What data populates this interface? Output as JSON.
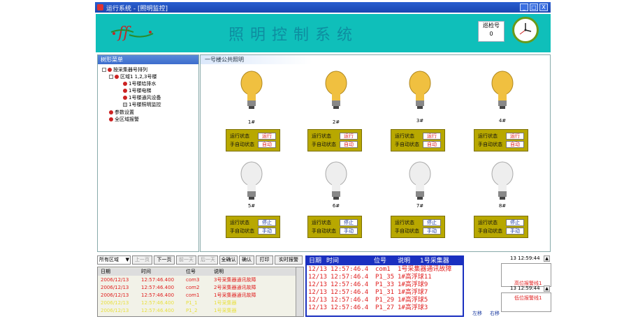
{
  "window": {
    "title": "运行系统 - [照明监控]",
    "min": "_",
    "restore": "□",
    "close": "X"
  },
  "header": {
    "system_title": "照明控制系统",
    "round_label": "巡检号",
    "round_value": "0"
  },
  "sidebar": {
    "title": "树形菜单",
    "tree": [
      {
        "label": "按采集器号排列",
        "level": 0
      },
      {
        "label": "区域1      1,2,3号楼",
        "level": 1
      },
      {
        "label": "1号楼给排水",
        "level": 2
      },
      {
        "label": "1号楼电梯",
        "level": 2
      },
      {
        "label": "1号楼通风设备",
        "level": 2
      },
      {
        "label": "1号楼照明监控",
        "level": 2
      },
      {
        "label": "参数设置",
        "level": 0
      },
      {
        "label": "全区域报警",
        "level": 0
      }
    ]
  },
  "main": {
    "title": "一号楼公共照明",
    "status_label": "运行状态",
    "mode_label": "手自动状态",
    "lamps": [
      {
        "label": "1#",
        "status": "运行",
        "mode": "自动",
        "on": true
      },
      {
        "label": "2#",
        "status": "运行",
        "mode": "自动",
        "on": true
      },
      {
        "label": "3#",
        "status": "运行",
        "mode": "自动",
        "on": true
      },
      {
        "label": "4#",
        "status": "运行",
        "mode": "自动",
        "on": true
      },
      {
        "label": "5#",
        "status": "停止",
        "mode": "手动",
        "on": false
      },
      {
        "label": "6#",
        "status": "停止",
        "mode": "手动",
        "on": false
      },
      {
        "label": "7#",
        "status": "停止",
        "mode": "手动",
        "on": false
      },
      {
        "label": "8#",
        "status": "停止",
        "mode": "手动",
        "on": false
      }
    ]
  },
  "toolbar": {
    "area_select": "所有区域",
    "buttons": [
      "上一页",
      "下一页",
      "前一天",
      "后一天",
      "全确认",
      "确认",
      "打印",
      "实时报警"
    ]
  },
  "history": {
    "columns": [
      "日期",
      "时间",
      "位号",
      "说明"
    ],
    "rows": [
      {
        "date": "2006/12/13",
        "time": "12:57:46.400",
        "tag": "com3",
        "desc": "3号采集器通讯故障"
      },
      {
        "date": "2006/12/13",
        "time": "12:57:46.400",
        "tag": "com2",
        "desc": "2号采集器通讯故障"
      },
      {
        "date": "2006/12/13",
        "time": "12:57:46.400",
        "tag": "com1",
        "desc": "1号采集器通讯故障"
      },
      {
        "date": "2006/12/13",
        "time": "12:57:46.400",
        "tag": "P1_1",
        "desc": "1号采集器"
      },
      {
        "date": "2006/12/13",
        "time": "12:57:46.400",
        "tag": "P1_2",
        "desc": "1号采集器"
      }
    ]
  },
  "realtime": {
    "header": {
      "date": "日期",
      "time": "时间",
      "tag": "位号",
      "desc": "说明",
      "source": "1号采集器"
    },
    "rows": [
      {
        "date": "12/13",
        "time": "12:57:46.4",
        "tag": "com1",
        "desc": "1号采集器通讯故障"
      },
      {
        "date": "12/13",
        "time": "12:57:46.4",
        "tag": "P1_35",
        "desc": "1#高浮球11"
      },
      {
        "date": "12/13",
        "time": "12:57:46.4",
        "tag": "P1_33",
        "desc": "1#高浮球9"
      },
      {
        "date": "12/13",
        "time": "12:57:46.4",
        "tag": "P1_31",
        "desc": "1#高浮球7"
      },
      {
        "date": "12/13",
        "time": "12:57:46.4",
        "tag": "P1_29",
        "desc": "1#高浮球5"
      },
      {
        "date": "12/13",
        "time": "12:57:46.4",
        "tag": "P1_27",
        "desc": "1#高浮球3"
      }
    ]
  },
  "alarm": {
    "timestamp1": "13 12:59:44",
    "text1": "高位报警线1",
    "timestamp2": "13 12:59:44",
    "text2": "低位报警线1",
    "left_label": "左移",
    "right_label": "右移"
  }
}
